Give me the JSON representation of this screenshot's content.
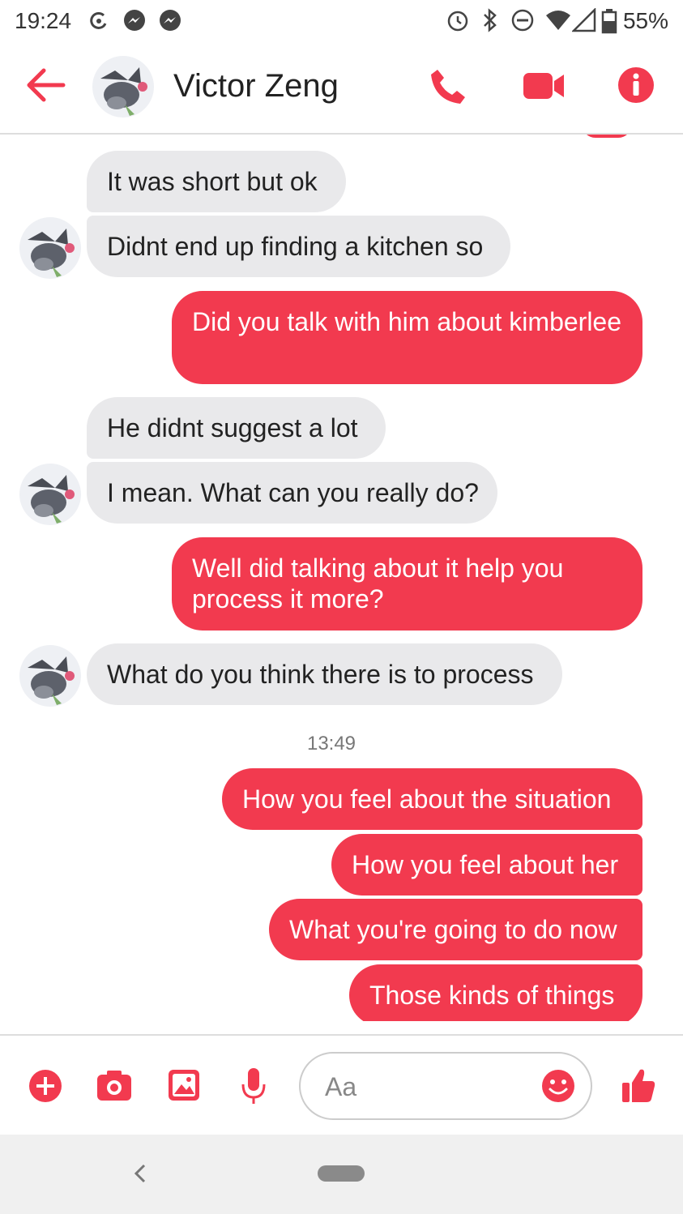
{
  "status_bar": {
    "time": "19:24",
    "battery": "55%",
    "icons": [
      "link-icon",
      "messenger-icon",
      "messenger-icon",
      "alarm-icon",
      "bluetooth-icon",
      "dnd-icon",
      "wifi-icon",
      "signal-icon",
      "battery-icon"
    ]
  },
  "header": {
    "contact_name": "Victor Zeng",
    "icons": [
      "back-arrow-icon",
      "phone-icon",
      "video-camera-icon",
      "info-icon"
    ]
  },
  "messages": [
    {
      "side": "in",
      "text": "It was short but ok"
    },
    {
      "side": "in",
      "text": "Didnt end up finding a kitchen so"
    },
    {
      "side": "out",
      "text": "Did you talk with him about kimberlee"
    },
    {
      "side": "in",
      "text": "He didnt suggest a lot"
    },
    {
      "side": "in",
      "text": "I mean. What can you really do?"
    },
    {
      "side": "out",
      "text": "Well did talking about it help you process it more?"
    },
    {
      "side": "in",
      "text": "What do you think there is to process"
    },
    {
      "side": "out",
      "text": "How you feel about the situation"
    },
    {
      "side": "out",
      "text": "How you feel about her"
    },
    {
      "side": "out",
      "text": "What you're going to do now"
    },
    {
      "side": "out",
      "text": "Those kinds of things"
    }
  ],
  "timestamp": "13:49",
  "composer": {
    "placeholder": "Aa",
    "icons": [
      "plus-icon",
      "camera-icon",
      "image-icon",
      "microphone-icon",
      "emoji-icon",
      "thumbs-up-icon"
    ]
  },
  "colors": {
    "accent": "#f23a4f",
    "incoming_bubble": "#e9e9eb"
  }
}
